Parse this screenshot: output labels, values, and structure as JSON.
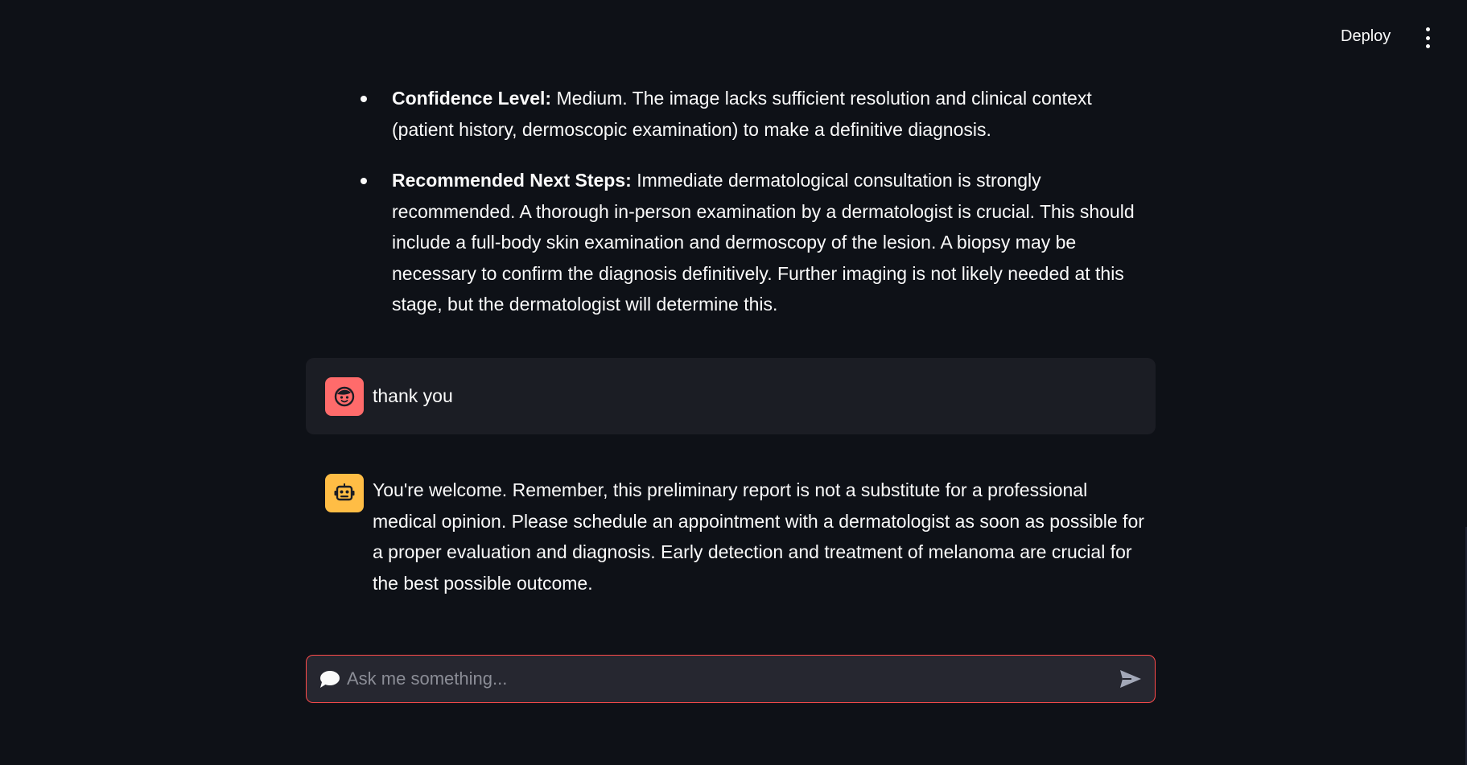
{
  "header": {
    "deploy_label": "Deploy",
    "menu_icon": "vertical-ellipsis-icon"
  },
  "assistant_previous": {
    "items": [
      {
        "heading": "Confidence Level:",
        "text": " Medium. The image lacks sufficient resolution and clinical context (patient history, dermoscopic examination) to make a definitive diagnosis."
      },
      {
        "heading": "Recommended Next Steps:",
        "text": " Immediate dermatological consultation is strongly recommended. A thorough in-person examination by a dermatologist is crucial. This should include a full-body skin examination and dermoscopy of the lesion. A biopsy may be necessary to confirm the diagnosis definitively. Further imaging is not likely needed at this stage, but the dermatologist will determine this."
      }
    ]
  },
  "messages": [
    {
      "role": "user",
      "avatar_icon": "user-face-icon",
      "text": "thank you"
    },
    {
      "role": "assistant",
      "avatar_icon": "robot-icon",
      "text": "You're welcome. Remember, this preliminary report is not a substitute for a professional medical opinion. Please schedule an appointment with a dermatologist as soon as possible for a proper evaluation and diagnosis. Early detection and treatment of melanoma are crucial for the best possible outcome."
    }
  ],
  "chat_input": {
    "placeholder": "Ask me something...",
    "value": "",
    "icon": "speech-bubble-icon",
    "send_icon": "send-arrow-icon"
  },
  "colors": {
    "background": "#0e1117",
    "user_message_bg": "#1b1d24",
    "user_avatar": "#ff6b6b",
    "assistant_avatar": "#ffbd45",
    "input_border": "#ff4b4b",
    "input_bg": "#262730"
  }
}
